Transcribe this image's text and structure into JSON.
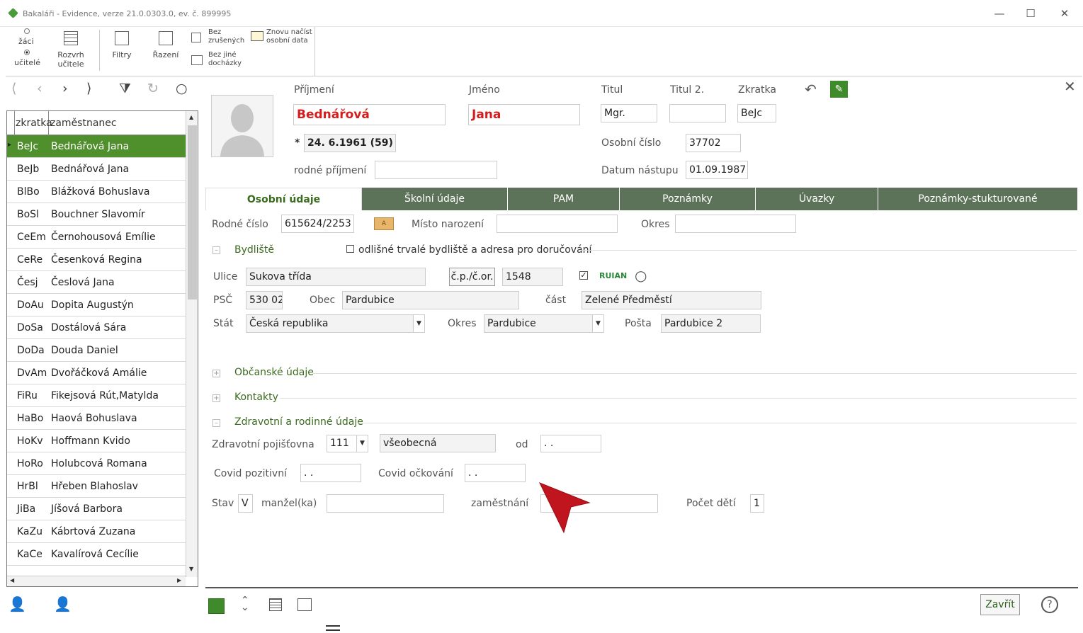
{
  "window": {
    "title": "Bakaláři - Evidence, verze 21.0.0303.0, ev. č. 899995",
    "minimize": "—",
    "maximize": "☐",
    "close": "✕"
  },
  "ribbon": {
    "radio_zaci": "žáci",
    "radio_ucitele": "učitelé",
    "rozvrh": "Rozvrh učitele",
    "filtry": "Filtry",
    "razeni": "Řazení",
    "bez_zrusenych": "Bez zrušených",
    "bez_jine_dochazky": "Bez jiné docházky",
    "znovu_nacist": "Znovu načíst osobní data"
  },
  "list": {
    "col_zkratka": "zkratka",
    "col_zamestnanec": "zaměstnanec",
    "rows": [
      {
        "zkratka": "BeJc",
        "name": "Bednářová Jana"
      },
      {
        "zkratka": "BeJb",
        "name": "Bednářová Jana"
      },
      {
        "zkratka": "BlBo",
        "name": "Blážková Bohuslava"
      },
      {
        "zkratka": "BoSl",
        "name": "Bouchner Slavomír"
      },
      {
        "zkratka": "CeEm",
        "name": "Černohousová Emílie"
      },
      {
        "zkratka": "CeRe",
        "name": "Česenková Regina"
      },
      {
        "zkratka": "Česj",
        "name": "Česlová Jana"
      },
      {
        "zkratka": "DoAu",
        "name": "Dopita Augustýn"
      },
      {
        "zkratka": "DoSa",
        "name": "Dostálová Sára"
      },
      {
        "zkratka": "DoDa",
        "name": "Douda Daniel"
      },
      {
        "zkratka": "DvAm",
        "name": "Dvořáčková Amálie"
      },
      {
        "zkratka": "FiRu",
        "name": "Fikejsová Rút,Matylda"
      },
      {
        "zkratka": "HaBo",
        "name": "Haová Bohuslava"
      },
      {
        "zkratka": "HoKv",
        "name": "Hoffmann Kvido"
      },
      {
        "zkratka": "HoRo",
        "name": "Holubcová Romana"
      },
      {
        "zkratka": "HrBl",
        "name": "Hřeben Blahoslav"
      },
      {
        "zkratka": "JiBa",
        "name": "Jíšová Barbora"
      },
      {
        "zkratka": "KaZu",
        "name": "Kábrtová Zuzana"
      },
      {
        "zkratka": "KaCe",
        "name": "Kavalírová Cecílie"
      }
    ]
  },
  "header": {
    "prijmeni_label": "Příjmení",
    "prijmeni": "Bednářová",
    "jmeno_label": "Jméno",
    "jmeno": "Jana",
    "titul_label": "Titul",
    "titul": "Mgr.",
    "titul2_label": "Titul 2.",
    "titul2": "",
    "zkratka_label": "Zkratka",
    "zkratka": "BeJc",
    "birth_star": "*",
    "birth": "24. 6.1961 (59)",
    "osobni_cislo_label": "Osobní číslo",
    "osobni_cislo": "37702",
    "rodne_prijmeni_label": "rodné příjmení",
    "rodne_prijmeni": "",
    "datum_nastupu_label": "Datum nástupu",
    "datum_nastupu": "01.09.1987"
  },
  "tabs": [
    "Osobní údaje",
    "Školní údaje",
    "PAM",
    "Poznámky",
    "Úvazky",
    "Poznámky-stukturované"
  ],
  "osobni": {
    "rodne_cislo_label": "Rodné číslo",
    "rodne_cislo": "615624/2253",
    "misto_narozeni_label": "Místo narození",
    "misto_narozeni": "",
    "okres_label": "Okres",
    "okres": "",
    "bydliste_label": "Bydliště",
    "odlisne_label": "odlišné trvalé bydliště a adresa pro doručování",
    "ulice_label": "Ulice",
    "ulice": "Sukova třída",
    "cp_button": "č.p./č.or.",
    "cp": "1548",
    "ruian": "RUIAN",
    "psc_label": "PSČ",
    "psc": "530 02",
    "obec_label": "Obec",
    "obec": "Pardubice",
    "cast_label": "část",
    "cast": "Zelené Předměstí",
    "stat_label": "Stát",
    "stat": "Česká republika",
    "okres2_label": "Okres",
    "okres2": "Pardubice",
    "posta_label": "Pošta",
    "posta": "Pardubice 2",
    "obcanske_label": "Občanské údaje",
    "kontakty_label": "Kontakty",
    "zdravotni_label": "Zdravotní a rodinné údaje",
    "pojistovna_label": "Zdravotní pojišťovna",
    "pojistovna_code": "111",
    "pojistovna_name": "všeobecná",
    "od_label": "od",
    "od": ". .",
    "covid_poz_label": "Covid pozitivní",
    "covid_poz": ". .",
    "covid_ock_label": "Covid očkování",
    "covid_ock": ". .",
    "stav_label": "Stav",
    "stav": "V",
    "manzel_label": "manžel(ka)",
    "manzel": "",
    "zamestnani_label": "zaměstnání",
    "zamestnani": "",
    "pocet_deti_label": "Počet dětí",
    "pocet_deti": "1"
  },
  "footer": {
    "zavrit": "Zavřít",
    "help": "?"
  },
  "colors": {
    "accent_green": "#4f8f2c",
    "tab_green": "#5d7359",
    "name_red": "#d41d1d",
    "arrow_red": "#c0141e"
  }
}
